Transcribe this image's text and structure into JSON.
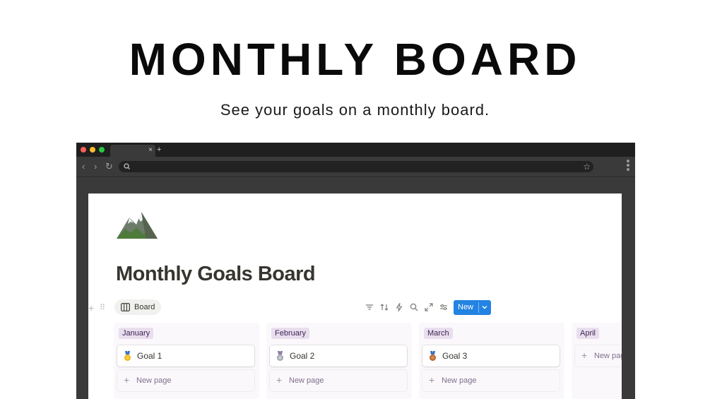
{
  "hero": {
    "title": "MONTHLY BOARD",
    "subtitle": "See your goals on a monthly board."
  },
  "browser": {
    "tab_close_icon": "×",
    "new_tab_icon": "+",
    "nav_back_icon": "‹",
    "nav_forward_icon": "›",
    "nav_reload_icon": "↻",
    "bookmark_icon": "☆"
  },
  "page": {
    "icon": "mountain-emoji-icon",
    "title": "Monthly Goals Board",
    "view_tab_label": "Board",
    "new_button_label": "New",
    "toolbar_icons": [
      "filter-icon",
      "sort-icon",
      "automation-icon",
      "search-icon",
      "expand-icon",
      "settings-icon"
    ],
    "add_block_icon": "+",
    "drag_handle_icon": "⠿"
  },
  "board": {
    "new_page_plus": "+",
    "columns": [
      {
        "name": "January",
        "card": {
          "title": "Goal 1",
          "medal": "gold-medal-icon"
        },
        "new_page_label": "New page"
      },
      {
        "name": "February",
        "card": {
          "title": "Goal 2",
          "medal": "silver-medal-icon"
        },
        "new_page_label": "New page"
      },
      {
        "name": "March",
        "card": {
          "title": "Goal 3",
          "medal": "bronze-medal-icon"
        },
        "new_page_label": "New page"
      },
      {
        "name": "April",
        "card": null,
        "new_page_label": "New page"
      }
    ]
  },
  "colors": {
    "accent": "#2383e2",
    "column_background": "#fbf8fc",
    "column_header": "#e8deee",
    "browser_chrome": "#3a3a3a"
  }
}
